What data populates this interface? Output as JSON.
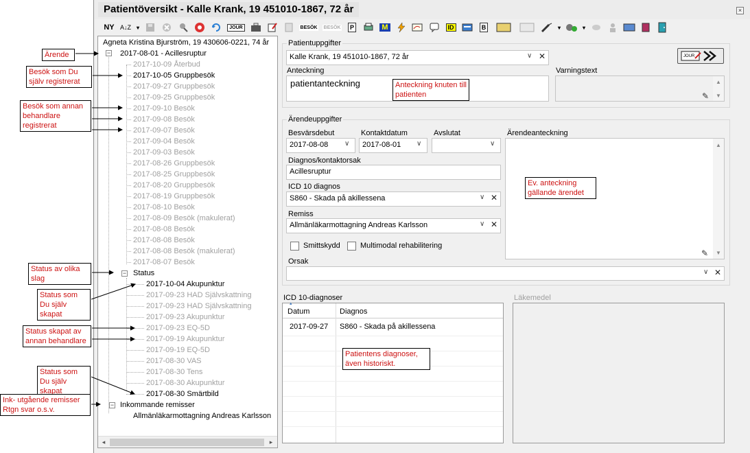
{
  "window": {
    "title": "Patientöversikt - Kalle Krank, 19 451010-1867, 72 år"
  },
  "toolbar": {
    "new_label": "NY",
    "sort_label": "A↓Z",
    "jour_label": "JOUR",
    "besok_label": "BESÖK",
    "besok2_label": "BESÖK",
    "id_label": "ID",
    "m_label": "M",
    "p_label": "P",
    "b_label": "B"
  },
  "tree": {
    "patient_header": "Agneta Kristina Bjurström, 19 430606-0221, 74 år",
    "arende": "2017-08-01 - Acillesruptur",
    "visits": [
      "2017-10-09 Återbud",
      "2017-10-05 Gruppbesök",
      "2017-09-27 Gruppbesök",
      "2017-09-25 Gruppbesök",
      "2017-09-10 Besök",
      "2017-09-08 Besök",
      "2017-09-07 Besök",
      "2017-09-04 Besök",
      "2017-09-03 Besök",
      "2017-08-26 Gruppbesök",
      "2017-08-25 Gruppbesök",
      "2017-08-20 Gruppbesök",
      "2017-08-19 Gruppbesök",
      "2017-08-10 Besök",
      "2017-08-09 Besök (makulerat)",
      "2017-08-08 Besök",
      "2017-08-08 Besök",
      "2017-08-08 Besök (makulerat)",
      "2017-08-07 Besök"
    ],
    "status_label": "Status",
    "status_items": [
      "2017-10-04 Akupunktur",
      "2017-09-23 HAD Självskattning",
      "2017-09-23 HAD Självskattning",
      "2017-09-23 Akupunktur",
      "2017-09-23 EQ-5D",
      "2017-09-19 Akupunktur",
      "2017-09-19 EQ-5D",
      "2017-08-30 VAS",
      "2017-08-30 Tens",
      "2017-08-30 Akupunktur",
      "2017-08-30 Smärtbild"
    ],
    "referrals_label": "Inkommande remisser",
    "referral_item": "Allmänläkarmottagning Andreas Karlsson"
  },
  "patient_section": {
    "group_label": "Patientuppgifter",
    "patient_value": "Kalle Krank, 19 451010-1867, 72 år",
    "note_label": "Anteckning",
    "note_value": "patientanteckning",
    "warning_label": "Varningstext",
    "warning_value": ""
  },
  "case_section": {
    "group_label": "Ärendeuppgifter",
    "onset_label": "Besvärsdebut",
    "onset_value": "2017-08-08",
    "contact_label": "Kontaktdatum",
    "contact_value": "2017-08-01",
    "closed_label": "Avslutat",
    "closed_value": "",
    "case_note_label": "Ärendeanteckning",
    "diag_reason_label": "Diagnos/kontaktorsak",
    "diag_reason_value": "Acillesruptur",
    "icd_label": "ICD 10 diagnos",
    "icd_value": "S860 - Skada på akillessena",
    "referral_label": "Remiss",
    "referral_value": "Allmänläkarmottagning Andreas Karlsson",
    "smittskydd_label": "Smittskydd",
    "multimodal_label": "Multimodal rehabilitering",
    "orsak_label": "Orsak",
    "orsak_value": ""
  },
  "icd_table": {
    "title": "ICD 10-diagnoser",
    "headers": [
      "Datum",
      "Diagnos"
    ],
    "rows": [
      [
        "2017-09-27",
        "S860 - Skada på akillessena"
      ]
    ]
  },
  "medicine": {
    "title": "Läkemedel"
  },
  "annotations": {
    "arende": "Ärende",
    "own_visit": "Besök som Du själv registrerat",
    "other_visit": "Besök som annan behandlare registrerat",
    "status_types": "Status av olika slag",
    "own_status_1": "Status som Du själv skapat",
    "other_status": "Status skapat av annan behandlare",
    "own_status_2": "Status som Du själv skapat",
    "referrals": "Ink- utgående remisser Rtgn svar o.s.v.",
    "patient_note": "Anteckning knuten till patienten",
    "case_note": "Ev. anteckning gällande ärendet",
    "diagnoses": "Patientens diagnoser, även historiskt."
  },
  "colors": {
    "annotation_text": "#cc1111",
    "window_bg": "#f0f0f0",
    "disabled_text": "#a0a0a0"
  }
}
